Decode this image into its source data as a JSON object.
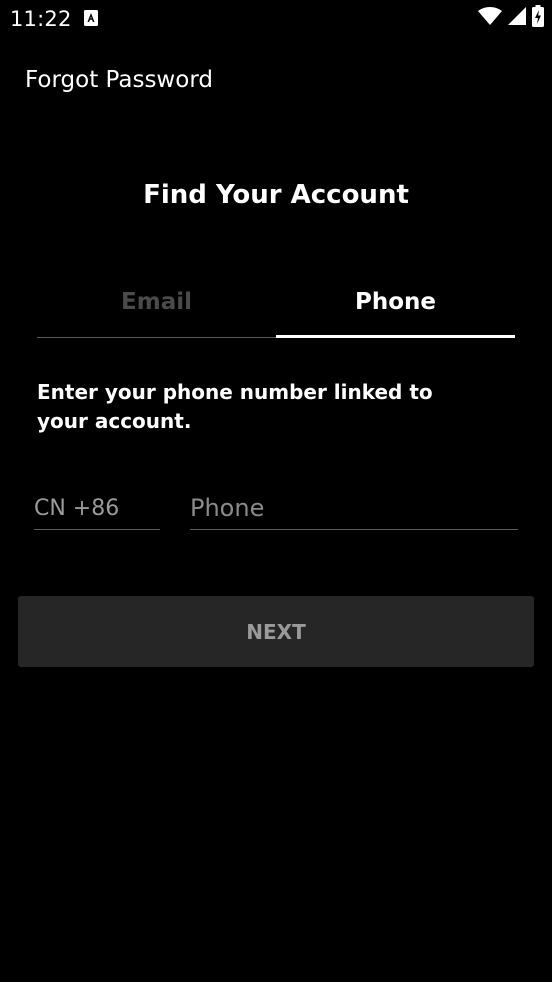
{
  "status_bar": {
    "time": "11:22",
    "icons": [
      "a-notification-icon",
      "wifi-icon",
      "signal-icon",
      "battery-charging-icon"
    ]
  },
  "app_bar": {
    "title": "Forgot Password"
  },
  "heading": "Find Your Account",
  "tabs": [
    {
      "label": "Email",
      "selected": false
    },
    {
      "label": "Phone",
      "selected": true
    }
  ],
  "description": "Enter your phone number linked to your account.",
  "country_code": {
    "value": "CN +86"
  },
  "phone": {
    "placeholder": "Phone",
    "value": ""
  },
  "next_button": {
    "label": "NEXT",
    "enabled": false
  },
  "colors": {
    "background": "#000000",
    "text": "#ffffff",
    "inactive_tab": "#4a4a4a",
    "button_bg": "#262626",
    "button_text": "#9a9a9a"
  }
}
